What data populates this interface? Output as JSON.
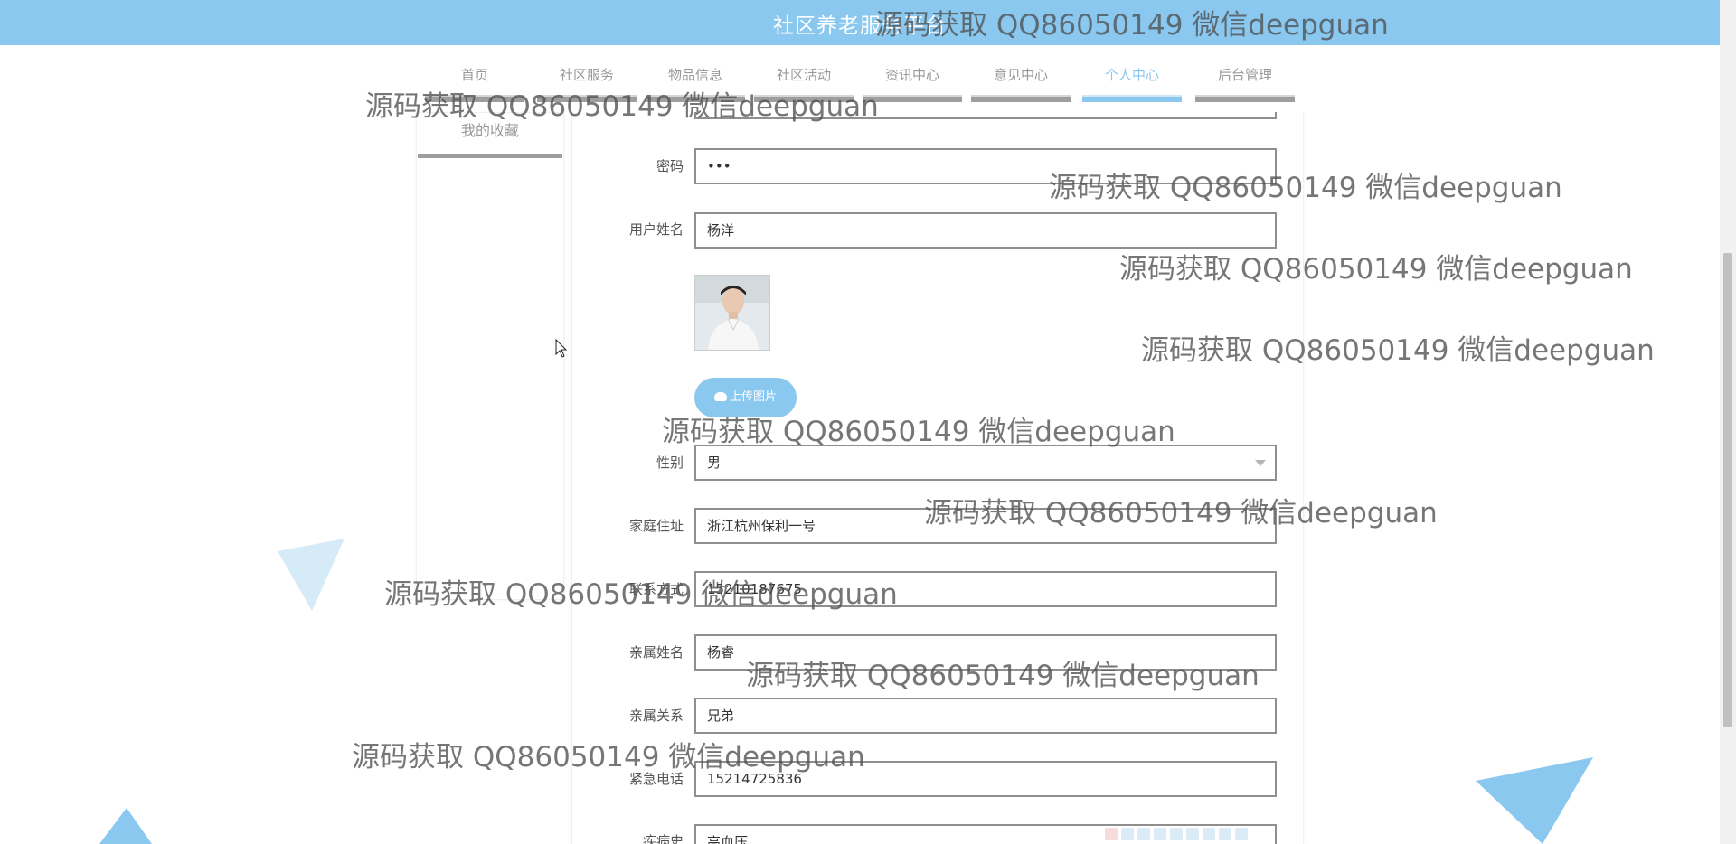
{
  "header": {
    "site_title": "社区养老服务平台"
  },
  "nav": {
    "items": [
      {
        "label": "首页"
      },
      {
        "label": "社区服务"
      },
      {
        "label": "物品信息"
      },
      {
        "label": "社区活动"
      },
      {
        "label": "资讯中心"
      },
      {
        "label": "意见中心"
      },
      {
        "label": "个人中心"
      },
      {
        "label": "后台管理"
      }
    ],
    "active": "个人中心",
    "active_color": "#8ac8f0"
  },
  "sidebar": {
    "items": [
      {
        "label": "我的收藏"
      }
    ]
  },
  "form": {
    "password": {
      "label": "密码",
      "value": "•••"
    },
    "username": {
      "label": "用户姓名",
      "value": "杨洋"
    },
    "upload_button": "上传图片",
    "gender": {
      "label": "性别",
      "value": "男"
    },
    "address": {
      "label": "家庭住址",
      "value": "浙江杭州保利一号"
    },
    "contact": {
      "label": "联系方式",
      "value": "15210187675"
    },
    "relative_name": {
      "label": "亲属姓名",
      "value": "杨睿"
    },
    "relation": {
      "label": "亲属关系",
      "value": "兄弟"
    },
    "emergency_phone": {
      "label": "紧急电话",
      "value": "15214725836"
    },
    "medical_history": {
      "label": "疾病史",
      "value": "高血压"
    }
  },
  "watermark": {
    "text": "源码获取 QQ86050149 微信deepguan"
  },
  "colors": {
    "header_bg": "#8ac8f0",
    "underline_gray": "#9e9e9e",
    "triangle_light": "#d6ebf8",
    "triangle_blue": "#8ac8f0"
  }
}
